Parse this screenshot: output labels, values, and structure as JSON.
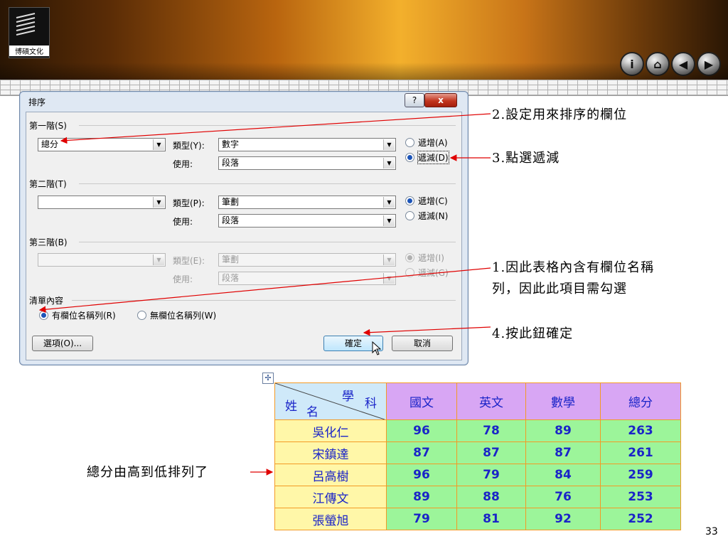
{
  "header": {
    "logo_text": "博碩文化",
    "nav_icons": [
      "info-icon",
      "home-icon",
      "back-icon",
      "forward-icon"
    ]
  },
  "dialog": {
    "title": "排序",
    "help_label": "?",
    "close_label": "x",
    "level1": {
      "label": "第一階(S)",
      "field_value": "總分",
      "type_label": "類型(Y):",
      "type_value": "數字",
      "use_label": "使用:",
      "use_value": "段落",
      "asc_label": "遞增(A)",
      "desc_label": "遞減(D)",
      "selected": "desc"
    },
    "level2": {
      "label": "第二階(T)",
      "field_value": "",
      "type_label": "類型(P):",
      "type_value": "筆劃",
      "use_label": "使用:",
      "use_value": "段落",
      "asc_label": "遞增(C)",
      "desc_label": "遞減(N)",
      "selected": "asc"
    },
    "level3": {
      "label": "第三階(B)",
      "field_value": "",
      "type_label": "類型(E):",
      "type_value": "筆劃",
      "use_label": "使用:",
      "use_value": "段落",
      "asc_label": "遞增(I)",
      "desc_label": "遞減(G)",
      "selected": "asc"
    },
    "list": {
      "label": "清單內容",
      "option_header": "有欄位名稱列(R)",
      "option_no_header": "無欄位名稱列(W)",
      "selected": "header"
    },
    "options_button": "選項(O)...",
    "ok_button": "確定",
    "cancel_button": "取消"
  },
  "annotations": {
    "note1": "2.設定用來排序的欄位",
    "note2": "3.點選遞減",
    "note3_line1": "1.因此表格內含有欄位名稱",
    "note3_line2": "列，因此此項目需勾選",
    "note4": "4.按此鈕確定",
    "note5": "總分由高到低排列了"
  },
  "table": {
    "corner_top": "學",
    "corner_top2": "科",
    "corner_left": "姓",
    "corner_left2": "名",
    "headers": [
      "國文",
      "英文",
      "數學",
      "總分"
    ],
    "rows": [
      {
        "name": "吳化仁",
        "values": [
          "96",
          "78",
          "89",
          "263"
        ]
      },
      {
        "name": "宋鎮達",
        "values": [
          "87",
          "87",
          "87",
          "261"
        ]
      },
      {
        "name": "呂高樹",
        "values": [
          "96",
          "79",
          "84",
          "259"
        ]
      },
      {
        "name": "江傳文",
        "values": [
          "89",
          "88",
          "76",
          "253"
        ]
      },
      {
        "name": "張螢旭",
        "values": [
          "79",
          "81",
          "92",
          "252"
        ]
      }
    ]
  },
  "page_number": "33",
  "colors": {
    "annotation_arrow": "#e00000",
    "table_border": "#f39a25",
    "header_bg": "#d8a6f4",
    "number_bg": "#9cf59a",
    "name_bg": "#fff7a8"
  }
}
